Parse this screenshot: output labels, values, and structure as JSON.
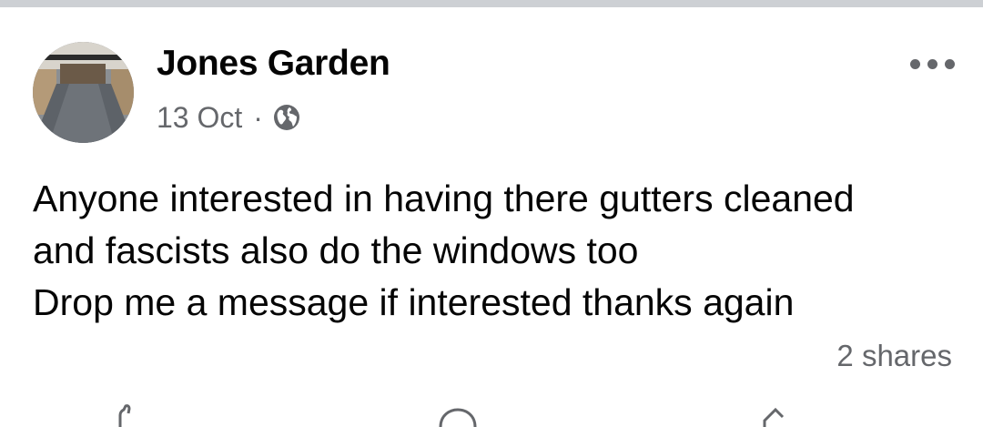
{
  "post": {
    "author": "Jones Garden",
    "date": "13 Oct",
    "separator": "·",
    "privacy_icon": "globe-icon",
    "more_icon": "more-horizontal-icon",
    "text_lines": [
      "Anyone interested in having there gutters cleaned",
      "and fascists also do the windows too",
      "Drop me a message if interested thanks again"
    ],
    "shares": "2 shares"
  },
  "actions": {
    "icons": [
      "like-icon",
      "comment-icon",
      "share-icon"
    ]
  },
  "colors": {
    "primary_text": "#050505",
    "secondary_text": "#65676b",
    "divider": "#cdd0d4",
    "background": "#ffffff"
  }
}
